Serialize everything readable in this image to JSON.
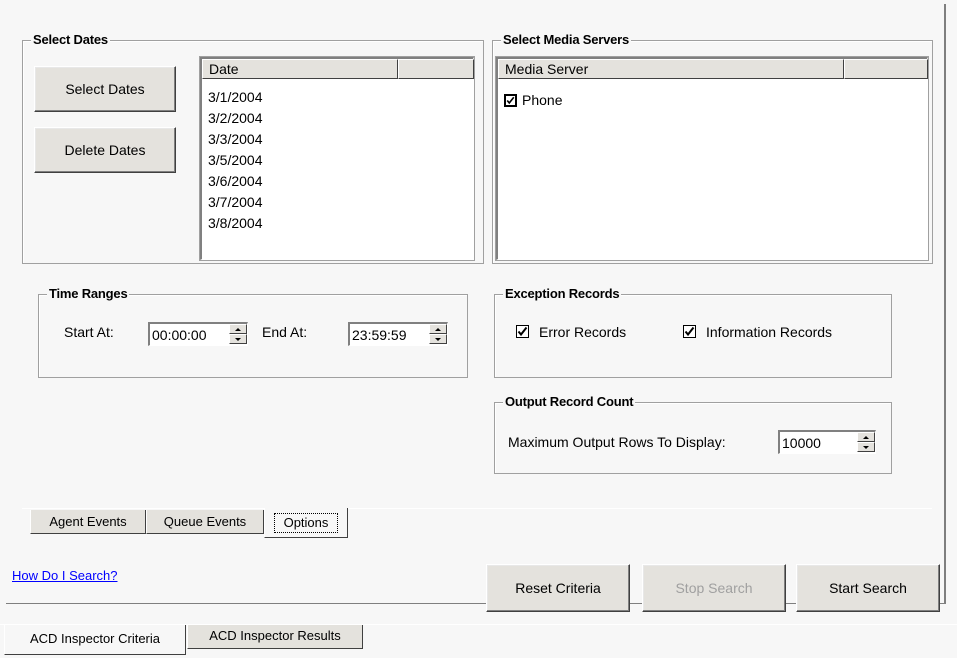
{
  "dates": {
    "title": "Select Dates",
    "select_button": "Select Dates",
    "delete_button": "Delete Dates",
    "column_header": "Date",
    "items": [
      "3/1/2004",
      "3/2/2004",
      "3/3/2004",
      "3/5/2004",
      "3/6/2004",
      "3/7/2004",
      "3/8/2004"
    ]
  },
  "media_servers": {
    "title": "Select Media Servers",
    "column_header": "Media Server",
    "items": [
      {
        "label": "Phone",
        "checked": true
      }
    ]
  },
  "time_ranges": {
    "title": "Time Ranges",
    "start_label": "Start At:",
    "start_value": "00:00:00",
    "end_label": "End At:",
    "end_value": "23:59:59"
  },
  "exception_records": {
    "title": "Exception Records",
    "error_label": "Error Records",
    "error_checked": true,
    "info_label": "Information Records",
    "info_checked": true
  },
  "output_count": {
    "title": "Output Record Count",
    "max_rows_label": "Maximum Output Rows To Display:",
    "max_rows_value": "10000"
  },
  "inner_tabs": [
    "Agent Events",
    "Queue Events",
    "Options"
  ],
  "inner_active_tab": "Options",
  "help_link": "How Do I Search?",
  "buttons": {
    "reset": "Reset Criteria",
    "stop": "Stop Search",
    "start": "Start Search"
  },
  "outer_tabs": [
    "ACD Inspector Criteria",
    "ACD Inspector Results"
  ],
  "outer_active_tab": "ACD Inspector Criteria",
  "colors": {
    "link": "#0000ff",
    "disabled_text": "#a0a0a0",
    "face": "#e4e2dd"
  }
}
